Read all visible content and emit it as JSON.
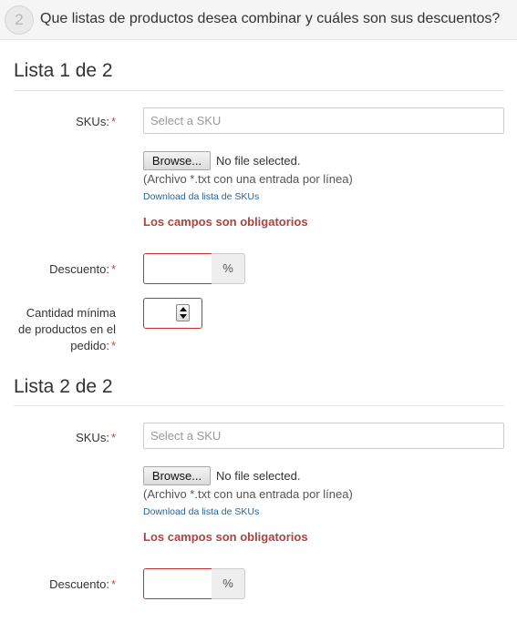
{
  "step": {
    "number": "2",
    "title": "Que listas de productos desea combinar y cuáles son sus descuentos?"
  },
  "lists": [
    {
      "heading": "Lista 1 de 2",
      "sku_label": "SKUs:",
      "sku_placeholder": "Select a SKU",
      "browse_label": "Browse...",
      "no_file": "No file selected.",
      "file_hint": "(Archivo *.txt con una entrada por línea)",
      "download_link": "Download da lista de SKUs",
      "error": "Los campos son obligatorios",
      "discount_label": "Descuento:",
      "discount_addon": "%",
      "min_qty_label_line1": "Cantidad mínima",
      "min_qty_label_line2": "de productos en el",
      "min_qty_label_line3": "pedido:"
    },
    {
      "heading": "Lista 2 de 2",
      "sku_label": "SKUs:",
      "sku_placeholder": "Select a SKU",
      "browse_label": "Browse...",
      "no_file": "No file selected.",
      "file_hint": "(Archivo *.txt con una entrada por línea)",
      "download_link": "Download da lista de SKUs",
      "error": "Los campos son obligatorios",
      "discount_label": "Descuento:",
      "discount_addon": "%"
    }
  ],
  "required_marker": "*",
  "colors": {
    "required": "#b94a48",
    "error_text": "#a94442",
    "error_border": "#c9302c",
    "link": "#2a6496"
  }
}
